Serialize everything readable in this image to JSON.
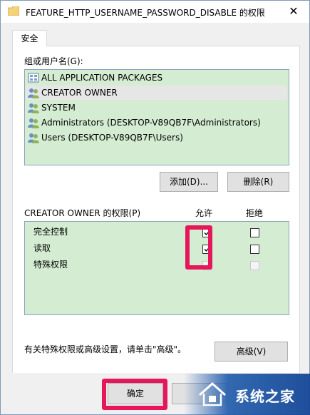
{
  "window": {
    "title": "FEATURE_HTTP_USERNAME_PASSWORD_DISABLE 的权限",
    "close_glyph": "✕"
  },
  "tabs": [
    {
      "label": "安全"
    }
  ],
  "groups": {
    "label": "组或用户名(G):",
    "items": [
      {
        "label": "ALL APPLICATION PACKAGES",
        "icon": "packages-icon",
        "selected": false
      },
      {
        "label": "CREATOR OWNER",
        "icon": "users-icon",
        "selected": true
      },
      {
        "label": "SYSTEM",
        "icon": "users-icon",
        "selected": false
      },
      {
        "label": "Administrators (DESKTOP-V89QB7F\\Administrators)",
        "icon": "users-icon",
        "selected": false
      },
      {
        "label": "Users (DESKTOP-V89QB7F\\Users)",
        "icon": "users-icon",
        "selected": false
      }
    ],
    "add_button": "添加(D)...",
    "remove_button": "删除(R)"
  },
  "permissions": {
    "label": "CREATOR OWNER 的权限(P)",
    "allow_header": "允许",
    "deny_header": "拒绝",
    "rows": [
      {
        "label": "完全控制",
        "allow": true,
        "deny": false,
        "disabled": false
      },
      {
        "label": "读取",
        "allow": true,
        "deny": false,
        "disabled": false
      },
      {
        "label": "特殊权限",
        "allow": true,
        "deny": false,
        "disabled": true
      }
    ]
  },
  "advanced": {
    "hint": "有关特殊权限或高级设置，请单击\"高级\"。",
    "button": "高级(V)"
  },
  "footer": {
    "ok_button": "确定"
  },
  "watermark": {
    "text": "系统之家"
  },
  "colors": {
    "highlight": "#e5175a",
    "list_bg": "#d4ecd2",
    "window_bg": "#f0f0f0"
  }
}
